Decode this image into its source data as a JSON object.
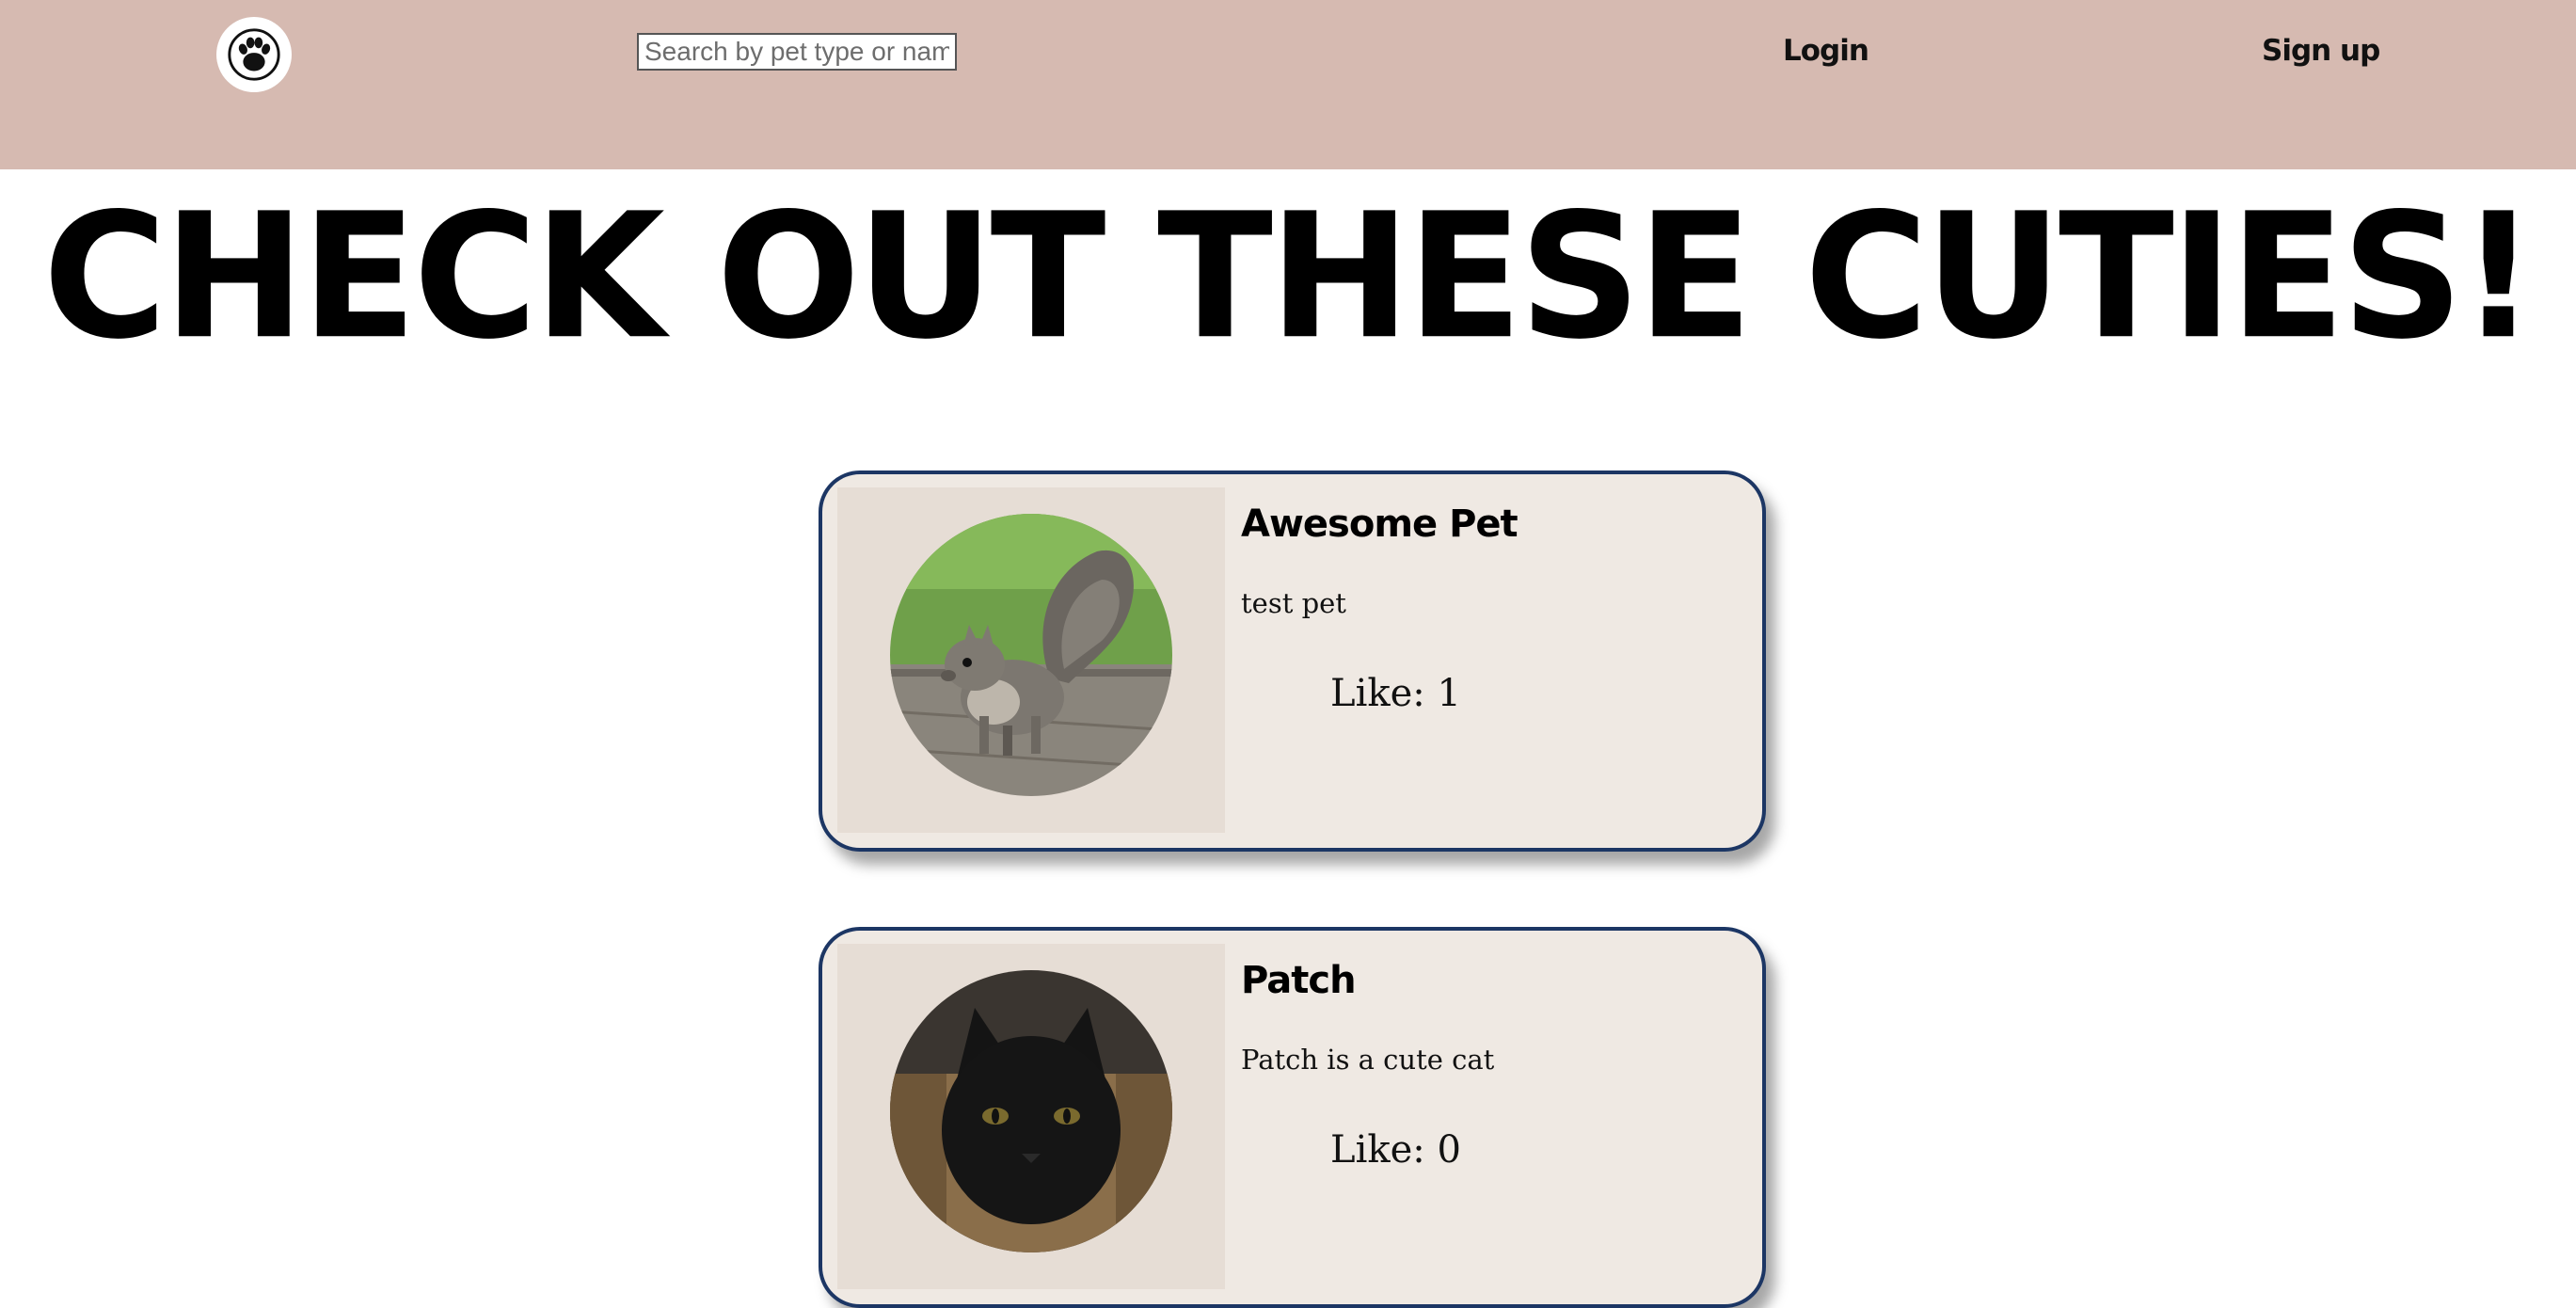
{
  "nav": {
    "logo_icon": "paw-icon",
    "search_placeholder": "Search by pet type or name",
    "login_label": "Login",
    "signup_label": "Sign up"
  },
  "headline": "CHECK OUT THESE CUTIES!",
  "pets": [
    {
      "name": "Awesome Pet",
      "description": "test pet",
      "likes_label": "Like: 1",
      "photo_subject": "squirrel"
    },
    {
      "name": "Patch",
      "description": "Patch is a cute cat",
      "likes_label": "Like: 0",
      "photo_subject": "black cat"
    }
  ],
  "colors": {
    "navbar_bg": "#d6bab1",
    "card_border": "#1c3664",
    "card_bg": "#efe9e3"
  }
}
